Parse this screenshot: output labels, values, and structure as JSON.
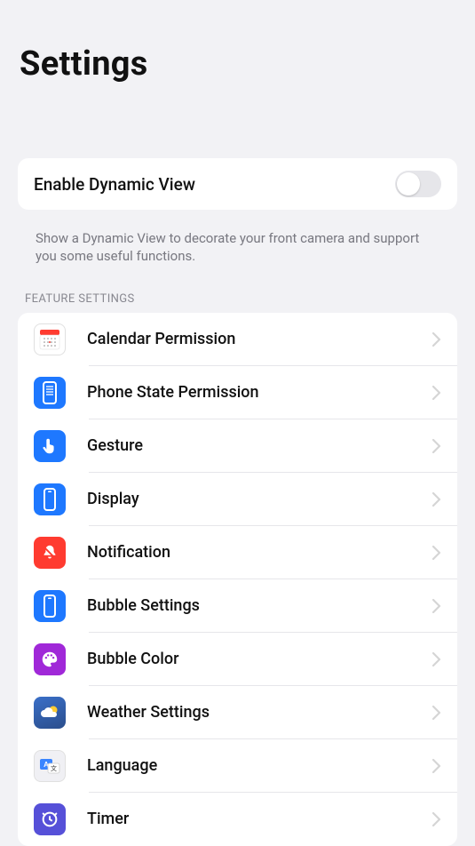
{
  "title": "Settings",
  "toggle": {
    "label": "Enable Dynamic View",
    "state": "off",
    "description": "Show a Dynamic View to decorate your front camera and support you some useful functions."
  },
  "sectionHeader": "FEATURE SETTINGS",
  "features": [
    {
      "id": "calendar",
      "label": "Calendar Permission",
      "icon": "calendar-icon",
      "color": "#ffffff"
    },
    {
      "id": "phonestate",
      "label": "Phone State Permission",
      "icon": "phone-icon",
      "color": "#1E78FF"
    },
    {
      "id": "gesture",
      "label": "Gesture",
      "icon": "hand-icon",
      "color": "#1E78FF"
    },
    {
      "id": "display",
      "label": "Display",
      "icon": "display-icon",
      "color": "#1E78FF"
    },
    {
      "id": "notification",
      "label": "Notification",
      "icon": "bell-icon",
      "color": "#FF3B30"
    },
    {
      "id": "bubble",
      "label": "Bubble Settings",
      "icon": "display-icon",
      "color": "#1E78FF"
    },
    {
      "id": "bubblecolor",
      "label": "Bubble Color",
      "icon": "palette-icon",
      "color": "#A028D8"
    },
    {
      "id": "weather",
      "label": "Weather Settings",
      "icon": "weather-icon",
      "color": "#3A6FC8"
    },
    {
      "id": "language",
      "label": "Language",
      "icon": "language-icon",
      "color": "#F0F0F4"
    },
    {
      "id": "timer",
      "label": "Timer",
      "icon": "timer-icon",
      "color": "#5650D8"
    }
  ]
}
